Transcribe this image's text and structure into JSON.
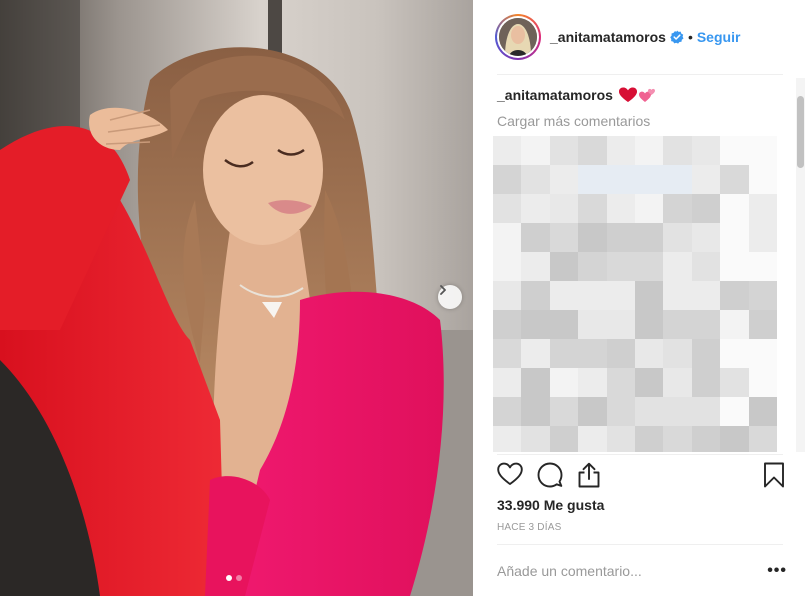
{
  "post": {
    "username": "_anitamatamoros",
    "verified": true,
    "separator": "•",
    "follow_label": "Seguir",
    "caption_username": "_anitamatamoros",
    "caption_emojis": [
      "red-heart",
      "two-pink-hearts"
    ],
    "load_more_label": "Cargar más comentarios",
    "likes_label": "33.990 Me gusta",
    "timestamp": "HACE 3 DÍAS",
    "comment_placeholder": "Añade un comentario...",
    "more_options": "•••",
    "carousel": {
      "slides": 2,
      "active_index": 0
    }
  },
  "icons": {
    "like": "heart-outline-icon",
    "comment": "speech-bubble-icon",
    "share": "share-upload-icon",
    "save": "bookmark-icon",
    "next": "chevron-right-icon",
    "verified": "verified-badge-icon"
  },
  "colors": {
    "link_blue": "#3897f0",
    "verified_blue": "#3897f0",
    "muted_text": "#999999",
    "primary_text": "#262626",
    "divider": "#efefef",
    "heart_red": "#e0245e",
    "heart_pink": "#f06292"
  }
}
